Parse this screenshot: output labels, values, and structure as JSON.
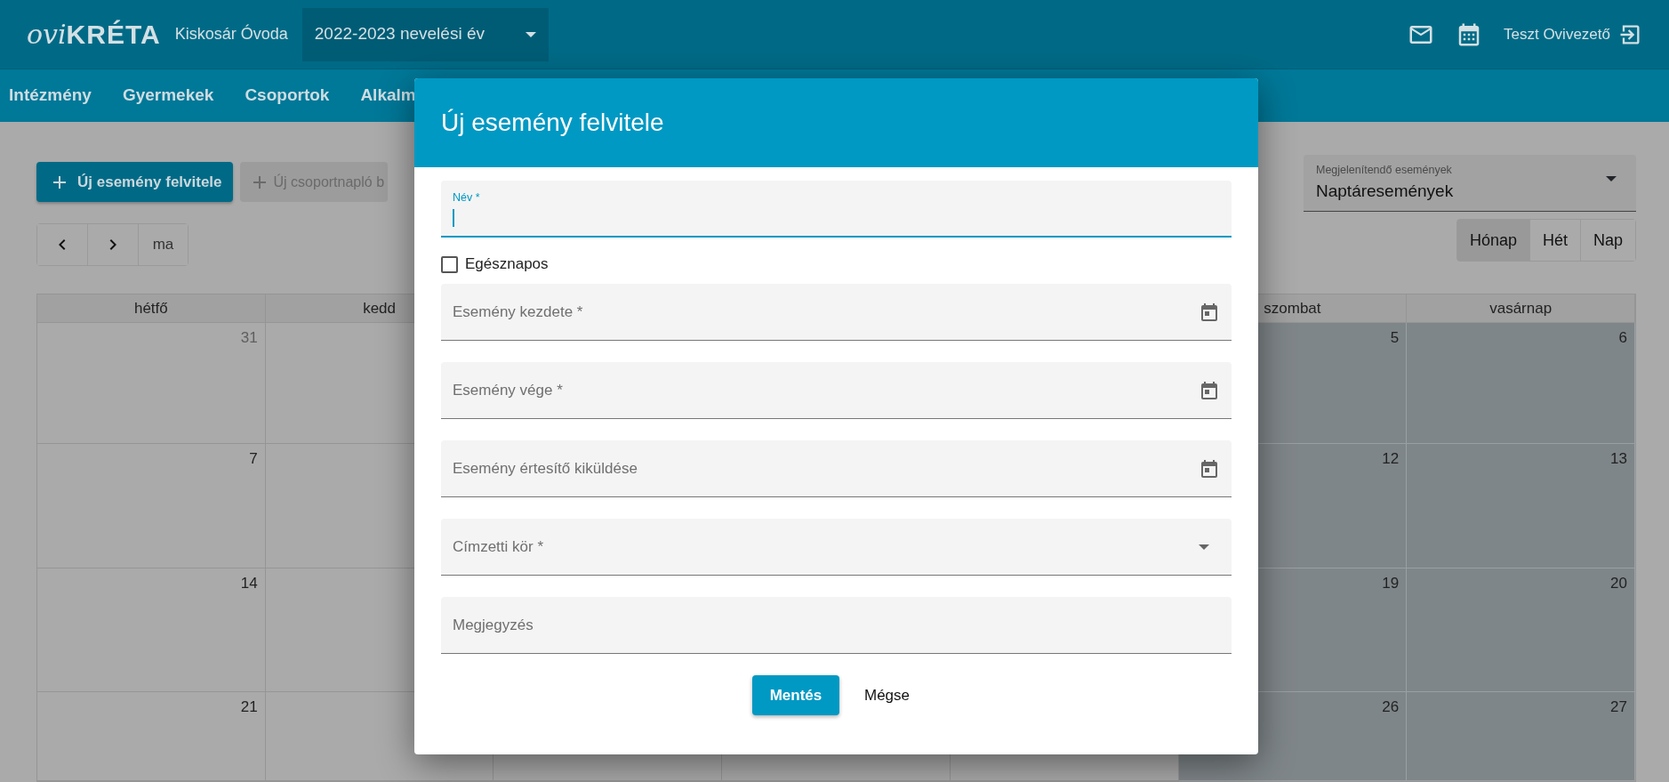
{
  "header": {
    "logo": {
      "part_1": "ovi",
      "part_2": "KRÉTA"
    },
    "institution": "Kiskosár Óvoda",
    "year_select": {
      "value": "2022-2023 nevelési év"
    },
    "user": "Teszt Ovivezető"
  },
  "nav": {
    "items": [
      {
        "label": "Intézmény"
      },
      {
        "label": "Gyermekek"
      },
      {
        "label": "Csoportok"
      },
      {
        "label": "Alkalm"
      }
    ]
  },
  "toolbar": {
    "buttons": [
      {
        "label": "Új esemény felvitele",
        "disabled": false
      },
      {
        "label": "Új csoportnapló b",
        "disabled": true
      }
    ],
    "nav_buttons": [
      {
        "kind": "prev"
      },
      {
        "kind": "next"
      },
      {
        "kind": "text",
        "label": "ma"
      }
    ]
  },
  "event_filter": {
    "label": "Megjelenítendő események",
    "value": "Naptáresemények"
  },
  "view_buttons": [
    {
      "label": "Hónap",
      "selected": true
    },
    {
      "label": "Hét",
      "selected": false
    },
    {
      "label": "Nap",
      "selected": false
    }
  ],
  "calendar": {
    "columns": {
      "column_1": {
        "label": "hétfő",
        "weekend": false
      },
      "column_2": {
        "label": "kedd",
        "weekend": false
      },
      "column_6": {
        "label": "szombat",
        "weekend": true
      },
      "column_7": {
        "label": "vasárnap",
        "weekend": true
      }
    },
    "weeks": [
      {
        "column_1": {
          "date": "31",
          "other_month": true
        },
        "column_6": {
          "date": "5",
          "other_month": false
        },
        "column_7": {
          "date": "6",
          "other_month": false
        }
      },
      {
        "column_1": {
          "date": "7",
          "other_month": false
        },
        "column_6": {
          "date": "12",
          "other_month": false
        },
        "column_7": {
          "date": "13",
          "other_month": false
        }
      },
      {
        "column_1": {
          "date": "14",
          "other_month": false
        },
        "column_6": {
          "date": "19",
          "other_month": false
        },
        "column_7": {
          "date": "20",
          "other_month": false
        }
      },
      {
        "column_1": {
          "date": "21",
          "other_month": false
        },
        "column_6": {
          "date": "26",
          "other_month": false
        },
        "column_7": {
          "date": "27",
          "other_month": false
        }
      }
    ]
  },
  "modal": {
    "title": "Új esemény felvitele",
    "fields": [
      {
        "kind": "text",
        "label": "Név *",
        "focused": true
      },
      {
        "kind": "checkbox",
        "label": "Egésznapos",
        "checked": false
      },
      {
        "kind": "date",
        "label": "Esemény kezdete *"
      },
      {
        "kind": "date",
        "label": "Esemény vége *"
      },
      {
        "kind": "date",
        "label": "Esemény értesítő kiküldése"
      },
      {
        "kind": "select",
        "label": "Címzetti kör *"
      },
      {
        "kind": "text",
        "label": "Megjegyzés",
        "focused": false
      }
    ],
    "buttons": [
      {
        "kind": "primary",
        "label": "Mentés"
      },
      {
        "kind": "link",
        "label": "Mégse"
      }
    ]
  }
}
